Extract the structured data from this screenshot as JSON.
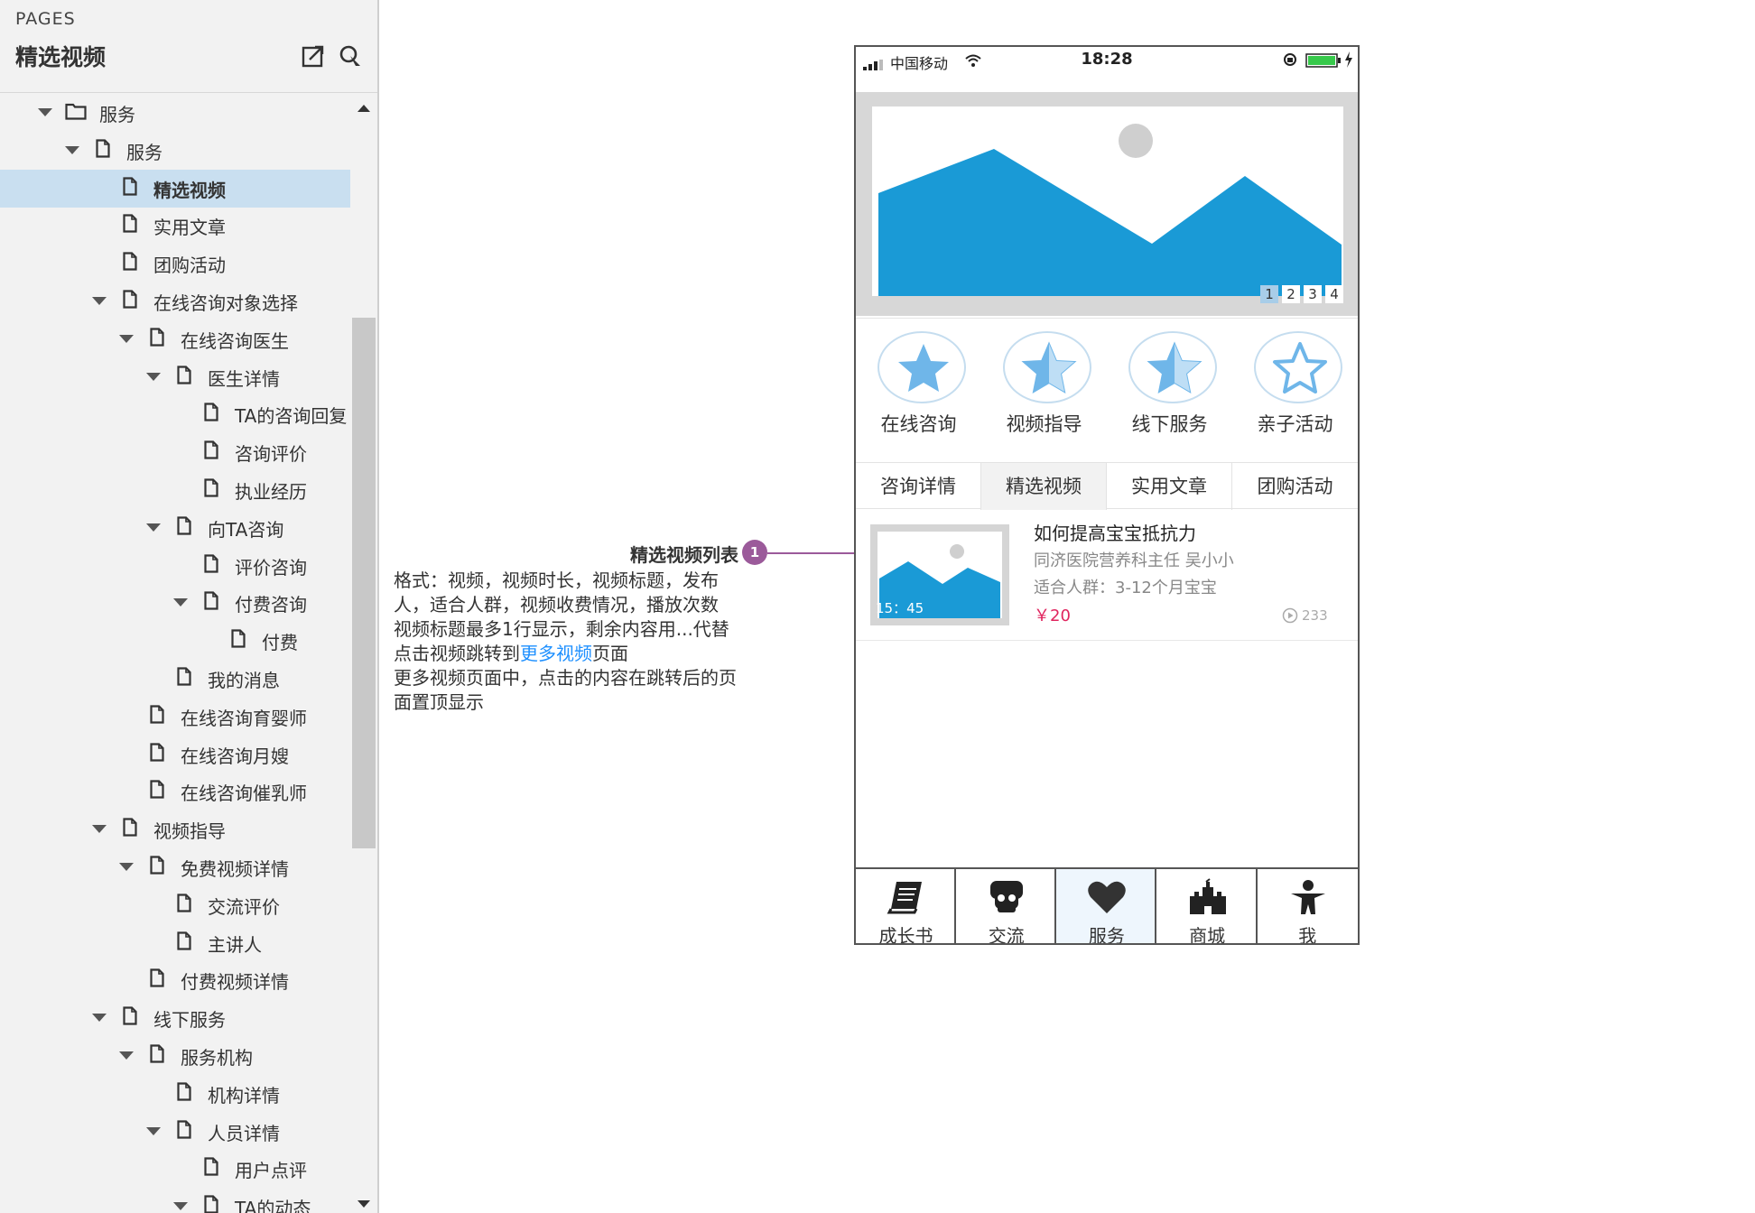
{
  "pages_panel": {
    "caption": "PAGES",
    "title": "精选视频",
    "tree": [
      {
        "label": "服务",
        "depth": 0,
        "kind": "folder",
        "expanded": true
      },
      {
        "label": "服务",
        "depth": 1,
        "kind": "page",
        "expanded": true
      },
      {
        "label": "精选视频",
        "depth": 2,
        "kind": "page",
        "selected": true
      },
      {
        "label": "实用文章",
        "depth": 2,
        "kind": "page"
      },
      {
        "label": "团购活动",
        "depth": 2,
        "kind": "page"
      },
      {
        "label": "在线咨询对象选择",
        "depth": 2,
        "kind": "page",
        "expanded": true
      },
      {
        "label": "在线咨询医生",
        "depth": 3,
        "kind": "page",
        "expanded": true
      },
      {
        "label": "医生详情",
        "depth": 4,
        "kind": "page",
        "expanded": true
      },
      {
        "label": "TA的咨询回复",
        "depth": 5,
        "kind": "page"
      },
      {
        "label": "咨询评价",
        "depth": 5,
        "kind": "page"
      },
      {
        "label": "执业经历",
        "depth": 5,
        "kind": "page"
      },
      {
        "label": "向TA咨询",
        "depth": 4,
        "kind": "page",
        "expanded": true
      },
      {
        "label": "评价咨询",
        "depth": 5,
        "kind": "page"
      },
      {
        "label": "付费咨询",
        "depth": 5,
        "kind": "page",
        "expanded": true
      },
      {
        "label": "付费",
        "depth": 6,
        "kind": "page"
      },
      {
        "label": "我的消息",
        "depth": 4,
        "kind": "page"
      },
      {
        "label": "在线咨询育婴师",
        "depth": 3,
        "kind": "page"
      },
      {
        "label": "在线咨询月嫂",
        "depth": 3,
        "kind": "page"
      },
      {
        "label": "在线咨询催乳师",
        "depth": 3,
        "kind": "page"
      },
      {
        "label": "视频指导",
        "depth": 2,
        "kind": "page",
        "expanded": true
      },
      {
        "label": "免费视频详情",
        "depth": 3,
        "kind": "page",
        "expanded": true
      },
      {
        "label": "交流评价",
        "depth": 4,
        "kind": "page"
      },
      {
        "label": "主讲人",
        "depth": 4,
        "kind": "page"
      },
      {
        "label": "付费视频详情",
        "depth": 3,
        "kind": "page"
      },
      {
        "label": "线下服务",
        "depth": 2,
        "kind": "page",
        "expanded": true
      },
      {
        "label": "服务机构",
        "depth": 3,
        "kind": "page",
        "expanded": true
      },
      {
        "label": "机构详情",
        "depth": 4,
        "kind": "page"
      },
      {
        "label": "人员详情",
        "depth": 4,
        "kind": "page",
        "expanded": true
      },
      {
        "label": "用户点评",
        "depth": 5,
        "kind": "page"
      },
      {
        "label": "TA的动态",
        "depth": 5,
        "kind": "page",
        "expanded": true
      }
    ]
  },
  "annotation": {
    "title": "精选视频列表",
    "badge": "1",
    "lines": [
      "格式：视频，视频时长，视频标题，发布",
      "人，适合人群，视频收费情况，播放次数",
      "视频标题最多1行显示，剩余内容用...代替"
    ],
    "click_prefix": "点击视频跳转到",
    "click_link": "更多视频",
    "click_suffix": "页面",
    "line5": "更多视频页面中，点击的内容在跳转后的页",
    "line6": "面置顶显示"
  },
  "phone": {
    "status": {
      "carrier": "中国移动",
      "time": "18:28"
    },
    "banner_dots": [
      "1",
      "2",
      "3",
      "4"
    ],
    "active_dot": 0,
    "quick_entries": [
      {
        "label": "在线咨询",
        "icon": "star-full-icon"
      },
      {
        "label": "视频指导",
        "icon": "star-half-icon"
      },
      {
        "label": "线下服务",
        "icon": "star-half-icon"
      },
      {
        "label": "亲子活动",
        "icon": "star-outline-icon"
      }
    ],
    "segment_tabs": [
      "咨询详情",
      "精选视频",
      "实用文章",
      "团购活动"
    ],
    "active_segment": 1,
    "video": {
      "duration": "15：45",
      "title": "如何提高宝宝抵抗力",
      "author": "同济医院营养科主任  吴小小",
      "audience": "适合人群：3-12个月宝宝",
      "price": "￥20",
      "plays": "233"
    },
    "tab_bar": [
      {
        "label": "成长书",
        "icon": "book-icon"
      },
      {
        "label": "交流",
        "icon": "chat-icon"
      },
      {
        "label": "服务",
        "icon": "heart-icon"
      },
      {
        "label": "商城",
        "icon": "castle-icon"
      },
      {
        "label": "我",
        "icon": "person-icon"
      }
    ],
    "active_tab": 2
  },
  "colors": {
    "accent_blue": "#1a9ad6",
    "badge_purple": "#9b5a9a",
    "price_red": "#e0245e",
    "selected_row": "#c9dff0"
  }
}
